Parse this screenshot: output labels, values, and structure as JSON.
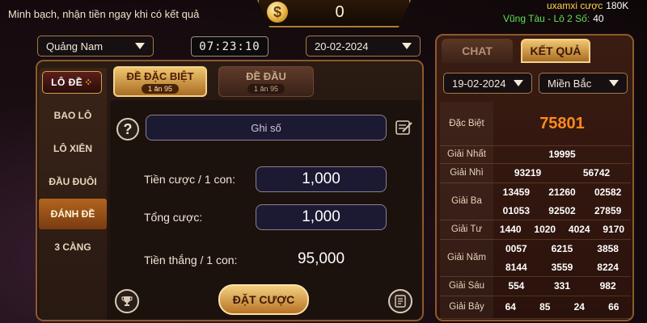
{
  "header": {
    "slogan": "Minh bạch, nhận tiền ngay khi có kết quả",
    "coin_symbol": "$",
    "balance": "0",
    "ticker": {
      "user": "uxamxi cược",
      "amount": "180K",
      "result": "Vũng Tàu - Lô 2 Số:",
      "count": "40"
    }
  },
  "controls": {
    "province": "Quảng Nam",
    "clock": "07:23:10",
    "date": "20-02-2024"
  },
  "sidebar": {
    "logo": "LÔ ĐỀ",
    "items": [
      {
        "label": "BAO LÔ"
      },
      {
        "label": "LÔ XIÊN"
      },
      {
        "label": "ĐẦU ĐUÔI"
      },
      {
        "label": "ĐÁNH ĐỀ",
        "active": true
      },
      {
        "label": "3 CÀNG"
      }
    ]
  },
  "tabs": [
    {
      "label": "ĐỀ ĐẶC BIỆT",
      "rate": "1 ăn 95",
      "active": true
    },
    {
      "label": "ĐỀ ĐẦU",
      "rate": "1 ăn 95",
      "active": false
    }
  ],
  "form": {
    "note_placeholder": "Ghi số",
    "bet_per_unit_label": "Tiền cược / 1 con:",
    "bet_per_unit_value": "1,000",
    "total_label": "Tổng cược:",
    "total_value": "1,000",
    "win_label": "Tiền thắng / 1 con:",
    "win_value": "95,000",
    "submit": "ĐẶT CƯỢC"
  },
  "results": {
    "tabs": {
      "chat": "CHAT",
      "result": "KẾT QUẢ"
    },
    "date": "19-02-2024",
    "region": "Miền Bắc",
    "prizes": [
      {
        "label": "Đặc Biệt",
        "lines": [
          [
            "75801"
          ]
        ]
      },
      {
        "label": "Giải Nhất",
        "lines": [
          [
            "19995"
          ]
        ]
      },
      {
        "label": "Giải Nhì",
        "lines": [
          [
            "93219",
            "56742"
          ]
        ]
      },
      {
        "label": "Giải Ba",
        "lines": [
          [
            "13459",
            "21260",
            "02582"
          ],
          [
            "01053",
            "92502",
            "27859"
          ]
        ]
      },
      {
        "label": "Giải Tư",
        "lines": [
          [
            "1440",
            "1020",
            "4024",
            "9170"
          ]
        ]
      },
      {
        "label": "Giải Năm",
        "lines": [
          [
            "0057",
            "6215",
            "3858"
          ],
          [
            "8144",
            "3559",
            "8224"
          ]
        ]
      },
      {
        "label": "Giải Sáu",
        "lines": [
          [
            "554",
            "331",
            "982"
          ]
        ]
      },
      {
        "label": "Giải Bảy",
        "lines": [
          [
            "64",
            "85",
            "24",
            "66"
          ]
        ]
      }
    ]
  },
  "colors": {
    "accent_gold": "#efc56e",
    "special_prize": "#ff8a1e",
    "ticker_green": "#5fe35a",
    "ticker_yellow": "#ffd54a"
  }
}
